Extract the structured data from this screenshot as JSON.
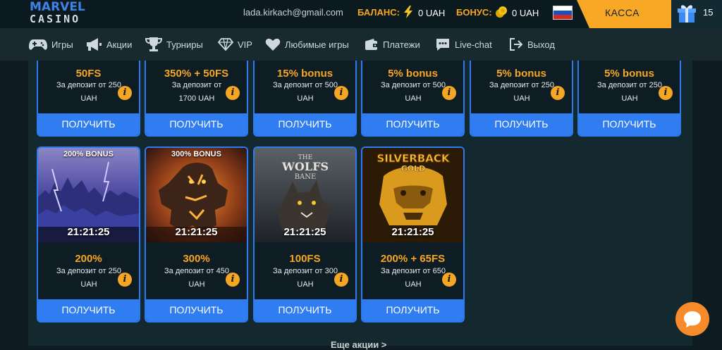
{
  "header": {
    "logo_line1": "MARVEL",
    "logo_line2": "CASINO",
    "email": "lada.kirkach@gmail.com",
    "balance_label": "БАЛАНС:",
    "balance_value": "0 UAH",
    "bonus_label": "БОНУС:",
    "bonus_value": "0 UAH",
    "cashier_label": "КАССА",
    "gift_count": "15",
    "accent_color": "#f9a825"
  },
  "nav": {
    "items": [
      {
        "label": "Игры",
        "icon": "gamepad-icon"
      },
      {
        "label": "Акции",
        "icon": "megaphone-icon"
      },
      {
        "label": "Турниры",
        "icon": "trophy-icon"
      },
      {
        "label": "VIP",
        "icon": "diamond-icon"
      },
      {
        "label": "Любимые игры",
        "icon": "heart-icon"
      },
      {
        "label": "Платежи",
        "icon": "wallet-icon"
      },
      {
        "label": "Live-chat",
        "icon": "chat-icon"
      },
      {
        "label": "Выход",
        "icon": "logout-icon"
      }
    ]
  },
  "promos_top": [
    {
      "title": "50FS",
      "desc1": "За депозит от 250",
      "desc2": "UAH",
      "button": "ПОЛУЧИТЬ"
    },
    {
      "title": "350% + 50FS",
      "desc1": "За депозит от",
      "desc2": "1700 UAH",
      "button": "ПОЛУЧИТЬ"
    },
    {
      "title": "15% bonus",
      "desc1": "За депозит от 500",
      "desc2": "UAH",
      "button": "ПОЛУЧИТЬ"
    },
    {
      "title": "5% bonus",
      "desc1": "За депозит от 500",
      "desc2": "UAH",
      "button": "ПОЛУЧИТЬ"
    },
    {
      "title": "5% bonus",
      "desc1": "За депозит от 250",
      "desc2": "UAH",
      "button": "ПОЛУЧИТЬ"
    },
    {
      "title": "5% bonus",
      "desc1": "За депозит от 250",
      "desc2": "UAH",
      "button": "ПОЛУЧИТЬ"
    }
  ],
  "promos_bottom": [
    {
      "badge": "200% BONUS",
      "timer": "21:21:25",
      "title": "200%",
      "desc1": "За депозит от 250",
      "desc2": "UAH",
      "button": "ПОЛУЧИТЬ"
    },
    {
      "badge": "300% BONUS",
      "timer": "21:21:25",
      "title": "300%",
      "desc1": "За депозит от 450",
      "desc2": "UAH",
      "button": "ПОЛУЧИТЬ"
    },
    {
      "badge": "",
      "game_line1": "THE",
      "game_line2": "WOLFS",
      "game_line3": "BANE",
      "timer": "21:21:25",
      "title": "100FS",
      "desc1": "За депозит от 300",
      "desc2": "UAH",
      "button": "ПОЛУЧИТЬ"
    },
    {
      "badge": "",
      "game_line1": "SILVERBACK",
      "game_line2": "GOLD",
      "timer": "21:21:25",
      "title": "200% + 65FS",
      "desc1": "За депозит от 650",
      "desc2": "UAH",
      "button": "ПОЛУЧИТЬ"
    }
  ],
  "more_label": "Еще акции >"
}
